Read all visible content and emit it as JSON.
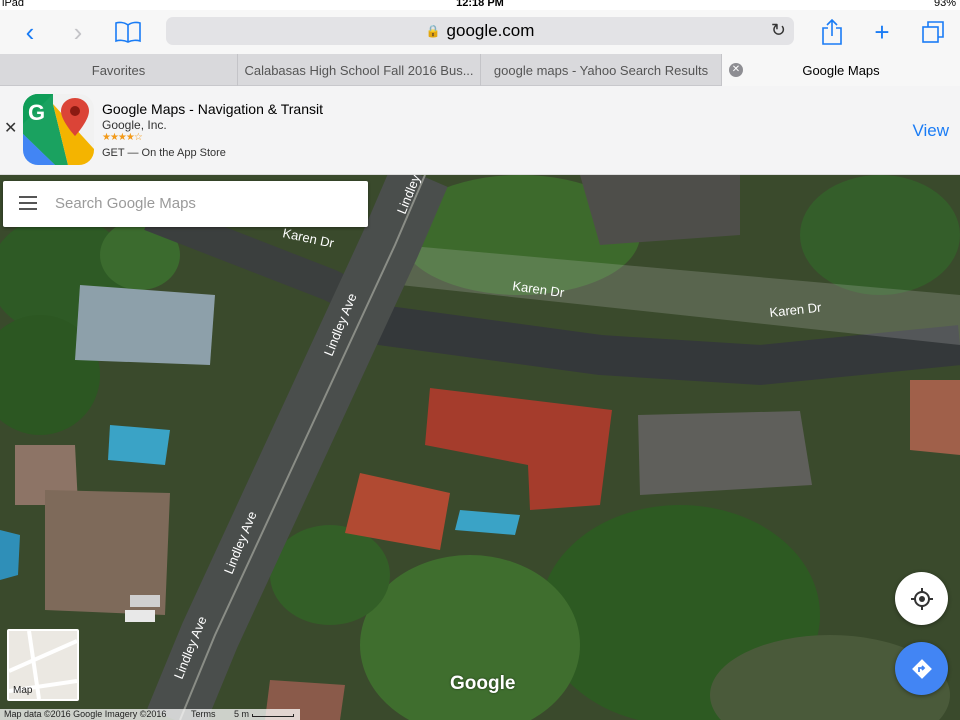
{
  "status": {
    "device": "iPad",
    "time": "12:18 PM",
    "battery": "93%"
  },
  "browser": {
    "url": "google.com",
    "tabs": [
      {
        "label": "Favorites"
      },
      {
        "label": "Calabasas High School Fall 2016 Bus..."
      },
      {
        "label": "google maps - Yahoo Search Results"
      },
      {
        "label": "Google Maps"
      }
    ]
  },
  "banner": {
    "app_name": "Google Maps - Navigation & Transit",
    "publisher": "Google, Inc.",
    "rating_stars": "★★★★☆",
    "get_text": "GET — On the App Store",
    "view_label": "View"
  },
  "map": {
    "search_placeholder": "Search Google Maps",
    "street_labels": [
      "Karen Dr",
      "Karen Dr",
      "Karen Dr",
      "Lindley Ave",
      "Lindley Ave",
      "Lindley Ave",
      "Lindley Ave"
    ],
    "map_toggle_label": "Map",
    "logo_text": "Google",
    "footer": {
      "data": "Map data ©2016 Google Imagery ©2016",
      "terms": "Terms",
      "scale": "5 m"
    }
  },
  "colors": {
    "accent": "#1a7cf5",
    "directions": "#4285f4"
  }
}
